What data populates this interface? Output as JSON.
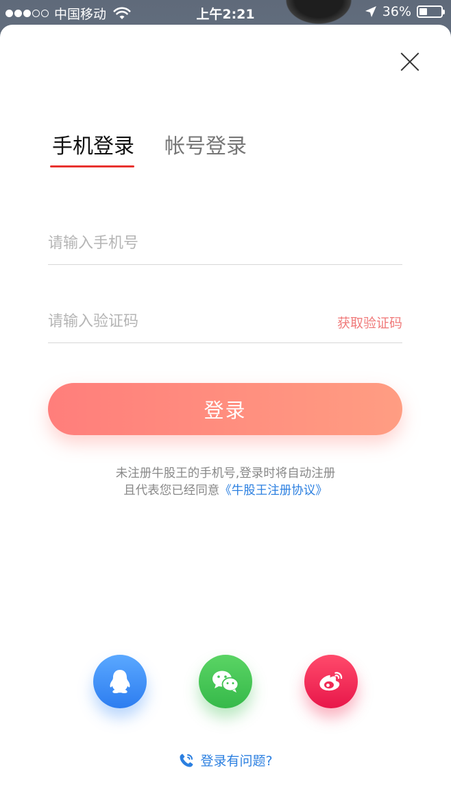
{
  "status_bar": {
    "carrier": "中国移动",
    "time": "上午2:21",
    "battery": "36%",
    "battery_level": 0.36,
    "signal_strength": 3,
    "signal_max": 5,
    "icons": [
      "signal-dots-icon",
      "wifi-icon",
      "location-arrow-icon",
      "battery-icon"
    ]
  },
  "tabs": [
    {
      "label": "手机登录",
      "active": true
    },
    {
      "label": "帐号登录",
      "active": false
    }
  ],
  "form": {
    "phone_placeholder": "请输入手机号",
    "phone_value": "",
    "code_placeholder": "请输入验证码",
    "code_value": "",
    "get_code_label": "获取验证码",
    "submit_label": "登录"
  },
  "notice": {
    "line1": "未注册牛股王的手机号,登录时将自动注册",
    "line2_prefix": "且代表您已经同意",
    "agreement_link": "《牛股王注册协议》"
  },
  "social_logins": [
    {
      "name": "qq",
      "icon": "qq-penguin-icon",
      "color": "#3d8cf5"
    },
    {
      "name": "wechat",
      "icon": "wechat-icon",
      "color": "#41c352"
    },
    {
      "name": "weibo",
      "icon": "weibo-icon",
      "color": "#f02a55"
    }
  ],
  "help": {
    "label": "登录有问题?",
    "icon": "phone-icon"
  },
  "colors": {
    "accent_red": "#e8322e",
    "button_gradient_start": "#ff7e7b",
    "button_gradient_end": "#ff9d82",
    "link_blue": "#2b7fe0",
    "get_code_color": "#f07b7b"
  }
}
